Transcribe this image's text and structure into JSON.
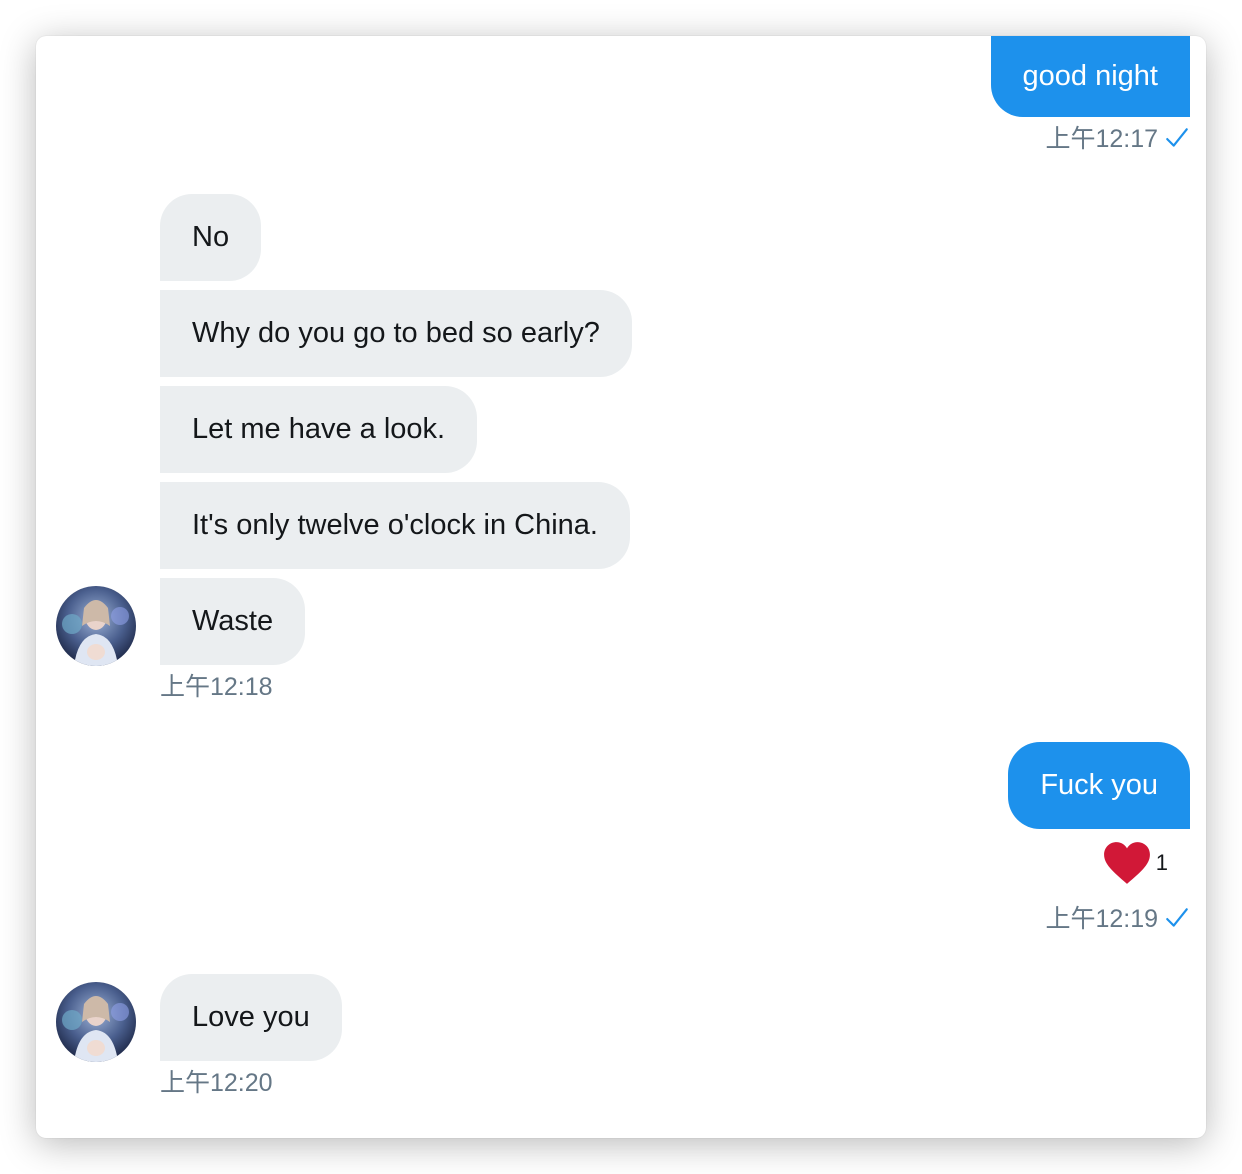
{
  "conversation": {
    "messages": [
      {
        "direction": "out",
        "text": "good night"
      },
      {
        "direction": "in",
        "text": "No"
      },
      {
        "direction": "in",
        "text": "Why do you go to bed so early?"
      },
      {
        "direction": "in",
        "text": "Let me have a look."
      },
      {
        "direction": "in",
        "text": "It's only twelve o'clock in China."
      },
      {
        "direction": "in",
        "text": "Waste"
      },
      {
        "direction": "out",
        "text": "Fuck you"
      },
      {
        "direction": "in",
        "text": "Love you"
      }
    ],
    "timestamps": {
      "t1": "上午12:17",
      "t2": "上午12:18",
      "t3": "上午12:19",
      "t4": "上午12:20"
    },
    "reaction": {
      "icon": "heart-icon",
      "count": "1"
    },
    "read_icon": "checkmark-icon"
  },
  "colors": {
    "outgoing_bubble": "#1d91ec",
    "incoming_bubble": "#ebeef0",
    "timestamp_text": "#657786",
    "heart": "#e0245e",
    "check": "#1d91ec"
  }
}
